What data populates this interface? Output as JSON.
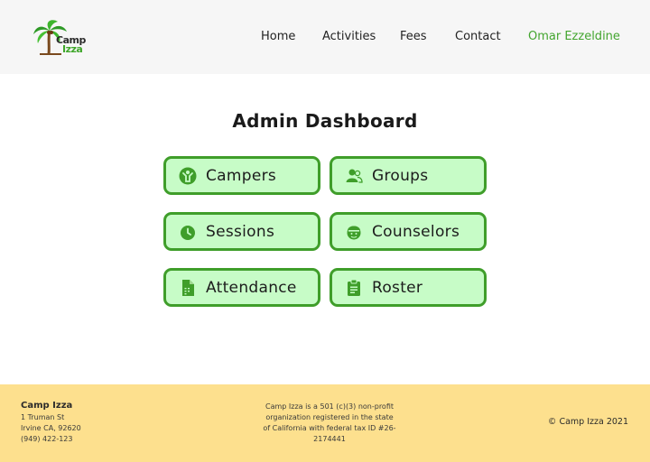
{
  "header": {
    "logo": {
      "line1": "Camp",
      "line2": "Izza"
    },
    "nav": [
      "Home",
      "Activities",
      "Fees",
      "Contact"
    ],
    "user": "Omar Ezzeldine"
  },
  "main": {
    "title": "Admin Dashboard",
    "tiles": [
      {
        "label": "Campers",
        "icon": "camper-icon"
      },
      {
        "label": "Groups",
        "icon": "groups-icon"
      },
      {
        "label": "Sessions",
        "icon": "clock-icon"
      },
      {
        "label": "Counselors",
        "icon": "counselor-icon"
      },
      {
        "label": "Attendance",
        "icon": "attendance-document-icon"
      },
      {
        "label": "Roster",
        "icon": "clipboard-icon"
      }
    ]
  },
  "footer": {
    "name": "Camp Izza",
    "address1": "1 Truman St",
    "address2": "Irvine CA, 92620",
    "phone": "(949) 422-123",
    "nonprofit": "Camp Izza is a 501 (c)(3) non-profit organization registered in the state of California with federal tax ID #26-2174441",
    "copyright": "© Camp Izza 2021"
  },
  "colors": {
    "accent_green": "#3f9e2a",
    "tile_fill": "#c7fcc7",
    "footer_bg": "#fde08e",
    "header_bg": "#f6f6f6"
  }
}
